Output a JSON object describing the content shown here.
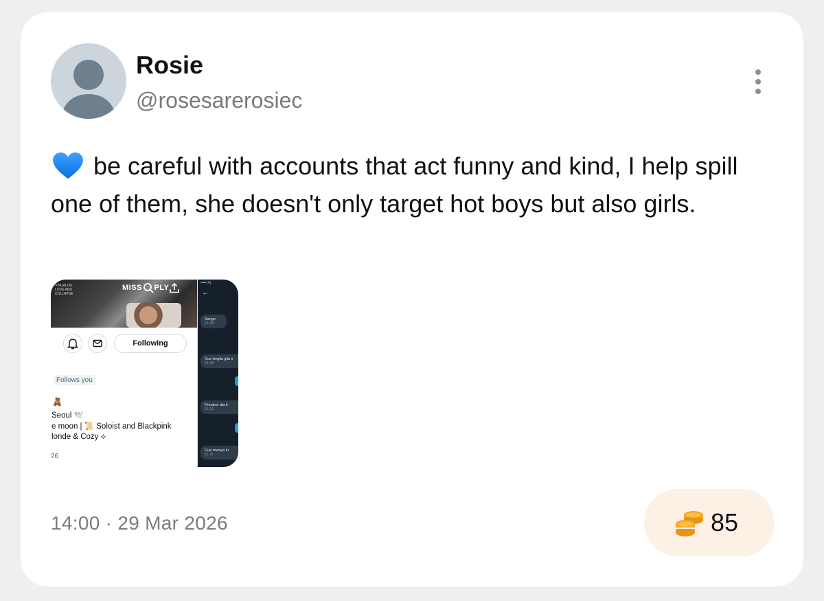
{
  "post": {
    "author_name": "Rosie",
    "author_handle": "@rosesarerosiec",
    "text": "be careful with accounts that act funny and kind, I help spill one of them, she doesn't only target hot boys but also girls.",
    "timestamp": "14:00 · 29 Mar 2026",
    "coins": "85"
  },
  "media": {
    "banner_title": "MISS",
    "banner_title_2": "PLY",
    "banner_small_text": "VISUALIZE LOVE AND COLLAPSE",
    "following_label": "Following",
    "follows_you_label": "Follows you",
    "bio_line_1": "Seoul 🕊️",
    "bio_line_2": "e moon | 📜 Soloist and Blackpink",
    "bio_line_3": "londe & Cozy ⟡",
    "bio_date": "26",
    "chat_status": "••••• XL",
    "chat_back": "←",
    "chat_messages": [
      {
        "text": "Sange",
        "time": "11.08"
      },
      {
        "text": "Gue tergila gila s",
        "time": "11.08"
      },
      {
        "text": "Prmainn dia k",
        "time": "11.10"
      },
      {
        "text": "Gue mwnya lu",
        "time": "11.11"
      }
    ]
  },
  "icons": {
    "heart": "blue-heart-icon",
    "more": "more-vertical-icon",
    "coin": "coin-stack-icon"
  },
  "colors": {
    "heart_blue": "#1e88f5",
    "coin_gold": "#f5a623",
    "pill_bg": "#fdf0e4",
    "muted_text": "#7b7b7b"
  }
}
